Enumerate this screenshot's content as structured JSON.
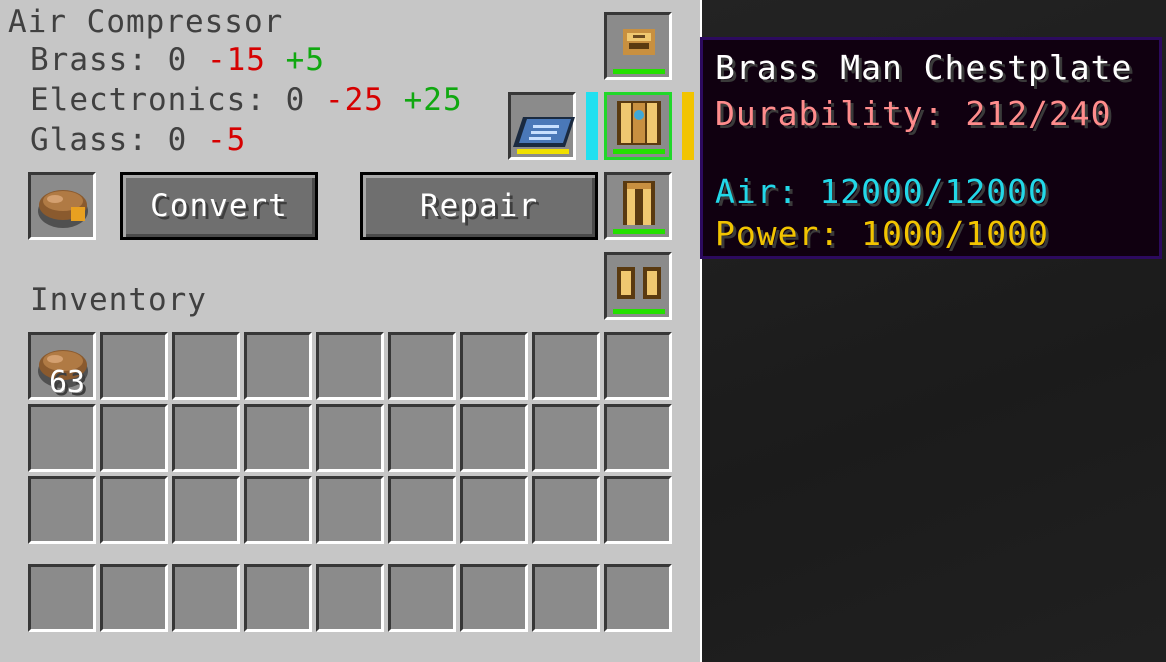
{
  "screen": {
    "title": "Air Compressor",
    "costs": [
      {
        "label": "Brass: 0",
        "neg": "-15",
        "pos": "+5"
      },
      {
        "label": "Electronics: 0",
        "neg": "-25",
        "pos": "+25"
      },
      {
        "label": "Glass: 0",
        "neg": "-5",
        "pos": ""
      }
    ],
    "buttons": {
      "convert": "Convert",
      "repair": "Repair"
    },
    "inventory_label": "Inventory",
    "inventory_first_count": "63"
  },
  "tooltip": {
    "name": "Brass Man Chestplate",
    "durability": "Durability: 212/240",
    "air": "Air: 12000/12000",
    "power": "Power: 1000/1000"
  },
  "colors": {
    "neg": "#d60000",
    "pos": "#10a810",
    "durability": "#ff8c8c",
    "air": "#22d8e8",
    "power": "#f2c400",
    "name": "#ffffff",
    "selected_slot": "#21d82a"
  },
  "icons": {
    "fuel_slot": "cake-icon",
    "helmet": "brass-helmet-icon",
    "chestplate": "brass-chestplate-icon",
    "leggings": "brass-leggings-icon",
    "boots": "brass-boots-icon",
    "book": "circuit-book-icon"
  }
}
